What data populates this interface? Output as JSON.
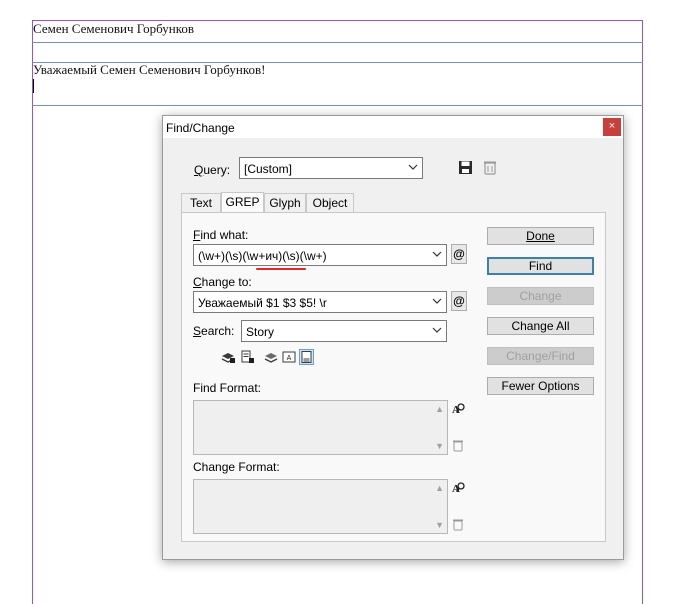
{
  "document": {
    "line1": "Семен Семенович Горбунков",
    "line2": "Уважаемый Семен Семенович Горбунков!"
  },
  "dialog": {
    "title": "Find/Change",
    "close_glyph": "×",
    "query": {
      "label": "Query:",
      "value": "[Custom]"
    },
    "tabs": [
      {
        "label": "Text"
      },
      {
        "label": "GREP"
      },
      {
        "label": "Glyph"
      },
      {
        "label": "Object"
      }
    ],
    "find_what": {
      "label": "Find what:",
      "value": "(\\w+)(\\s)(\\w+ич)(\\s)(\\w+)"
    },
    "change_to": {
      "label": "Change to:",
      "value": "Уважаемый $1 $3 $5! \\r"
    },
    "search": {
      "label": "Search:",
      "value": "Story"
    },
    "find_format": {
      "label": "Find Format:"
    },
    "change_format": {
      "label": "Change Format:"
    },
    "special_char_glyph": "@",
    "buttons": {
      "done": "Done",
      "find": "Find",
      "change": "Change",
      "change_all": "Change All",
      "change_find": "Change/Find",
      "fewer_options": "Fewer Options"
    }
  },
  "colors": {
    "accent": "#3c7fb1",
    "close": "#c9403a",
    "highlight_underline": "#e0282c"
  }
}
